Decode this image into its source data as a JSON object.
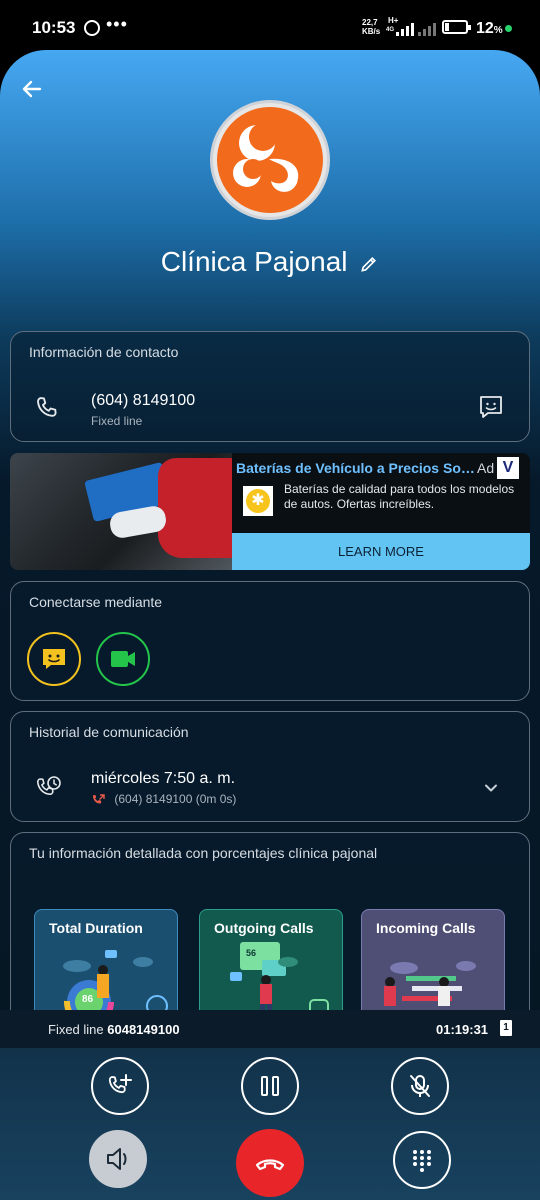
{
  "status_bar": {
    "time": "10:53",
    "dots": "•••",
    "net_speed": "22,7",
    "net_unit": "KB/s",
    "net_type": "H+",
    "net_sub": "4G",
    "battery_pct": "12",
    "battery_sym": "%"
  },
  "contact": {
    "name": "Clínica Pajonal"
  },
  "contact_info": {
    "title": "Información de contacto",
    "number": "(604) 8149100",
    "type": "Fixed line"
  },
  "ad": {
    "title": "Baterías de Vehículo a Precios Sor...",
    "badge": "Ad",
    "logo": "V",
    "description": "Baterías de calidad para todos los modelos de autos. Ofertas increíbles.",
    "cta": "LEARN MORE"
  },
  "connect": {
    "title": "Conectarse mediante"
  },
  "history": {
    "title": "Historial de comunicación",
    "date": "miércoles 7:50 a. m.",
    "detail": "(604) 8149100 (0m 0s)"
  },
  "insights": {
    "title": "Tu información detallada con porcentajes clínica pajonal",
    "cards": [
      {
        "label": "Total Duration"
      },
      {
        "label": "Outgoing Calls"
      },
      {
        "label": "Incoming Calls"
      }
    ],
    "donut_value": "86",
    "badge_value": "56"
  },
  "call_bar": {
    "line_label": "Fixed line",
    "line_number": "6048149100",
    "timer": "01:19:31",
    "sim": "1"
  },
  "colors": {
    "accent_blue": "#46a8f2",
    "chat_yellow": "#f4c21f",
    "video_green": "#24c44a",
    "end_call_red": "#e8262a",
    "ad_cta": "#62c4f3"
  }
}
